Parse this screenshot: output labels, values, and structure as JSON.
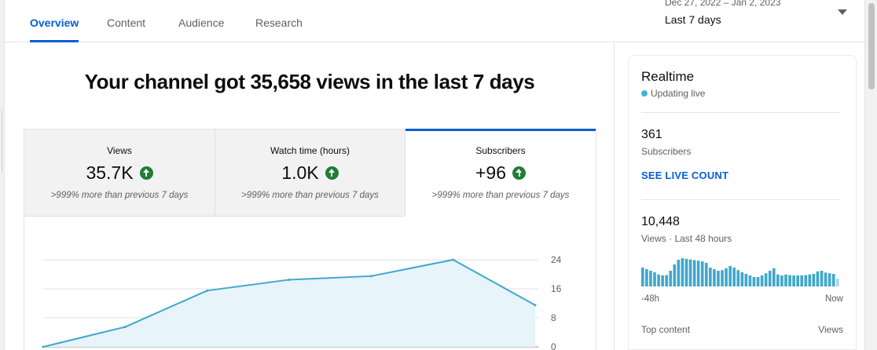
{
  "tabs": [
    {
      "label": "Overview",
      "active": true
    },
    {
      "label": "Content",
      "active": false
    },
    {
      "label": "Audience",
      "active": false
    },
    {
      "label": "Research",
      "active": false
    }
  ],
  "date_picker": {
    "range": "Dec 27, 2022 – Jan 2, 2023",
    "label": "Last 7 days"
  },
  "headline": "Your channel got 35,658 views in the last 7 days",
  "metrics": [
    {
      "title": "Views",
      "value": "35.7K",
      "compare": ">999% more than previous 7 days",
      "selected": false
    },
    {
      "title": "Watch time (hours)",
      "value": "1.0K",
      "compare": ">999% more than previous 7 days",
      "selected": false
    },
    {
      "title": "Subscribers",
      "value": "+96",
      "compare": ">999% more than previous 7 days",
      "selected": true
    }
  ],
  "chart_data": {
    "type": "area",
    "x": [
      1,
      2,
      3,
      4,
      5,
      6,
      7
    ],
    "values": [
      0,
      5.5,
      15.5,
      18.5,
      19.5,
      24,
      11.5
    ],
    "ylim": [
      0,
      24
    ],
    "yticks": [
      "24",
      "16",
      "8",
      "0"
    ],
    "ytick_values": [
      24,
      16,
      8,
      0
    ],
    "grid": true,
    "line_color": "#41a7cc",
    "fill_color": "#e7f4fa"
  },
  "realtime": {
    "title": "Realtime",
    "status": "Updating live",
    "subscribers_value": "361",
    "subscribers_label": "Subscribers",
    "live_count_link": "SEE LIVE COUNT",
    "views_value": "10,448",
    "views_label": "Views · Last 48 hours",
    "axis_start": "-48h",
    "axis_end": "Now",
    "top_content_label": "Top content",
    "top_content_column": "Views",
    "hourly_views": [
      60,
      55,
      50,
      45,
      38,
      35,
      36,
      50,
      70,
      85,
      90,
      88,
      86,
      84,
      82,
      80,
      75,
      60,
      55,
      50,
      52,
      58,
      65,
      60,
      52,
      45,
      40,
      35,
      30,
      30,
      35,
      42,
      50,
      58,
      38,
      35,
      38,
      36,
      35,
      35,
      35,
      36,
      38,
      40,
      48,
      50,
      44,
      42,
      40,
      25
    ],
    "bar_color": "#41a7cc"
  },
  "colors": {
    "accent": "#065fd4",
    "positive": "#1e7e34"
  }
}
